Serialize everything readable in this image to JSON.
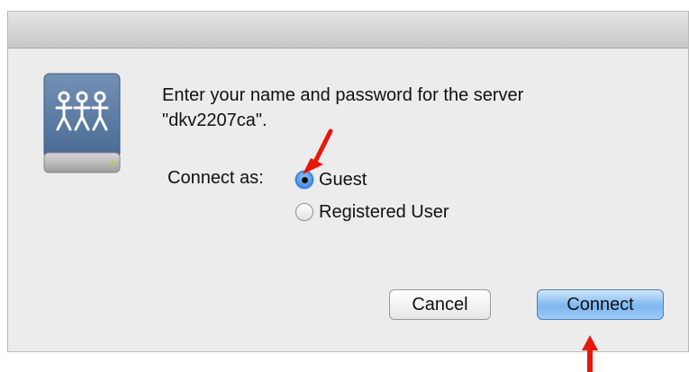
{
  "dialog": {
    "message_line1": "Enter your name and password for the server",
    "message_line2": "\"dkv2207ca\".",
    "connect_as_label": "Connect as:",
    "options": [
      {
        "label": "Guest",
        "selected": true
      },
      {
        "label": "Registered User",
        "selected": false
      }
    ],
    "cancel_label": "Cancel",
    "connect_label": "Connect"
  },
  "icons": {
    "server": "network-server-drive-icon",
    "arrow_guest": "red-arrow-icon",
    "arrow_connect": "red-arrow-icon"
  },
  "colors": {
    "annotation_arrow": "#e8160c",
    "default_button": "#7db7f0",
    "icon_blue": "#5b79a0"
  }
}
